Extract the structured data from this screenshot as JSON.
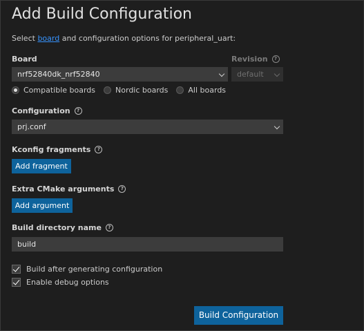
{
  "title": "Add Build Configuration",
  "intro": {
    "before": "Select ",
    "link": "board",
    "after": " and configuration options for peripheral_uart:"
  },
  "board": {
    "label": "Board",
    "value": "nrf52840dk_nrf52840"
  },
  "revision": {
    "label": "Revision",
    "value": "default"
  },
  "board_filter": {
    "options": [
      "Compatible boards",
      "Nordic boards",
      "All boards"
    ],
    "selected": "Compatible boards"
  },
  "configuration": {
    "label": "Configuration",
    "value": "prj.conf"
  },
  "kconfig": {
    "label": "Kconfig fragments",
    "button": "Add fragment"
  },
  "cmake": {
    "label": "Extra CMake arguments",
    "button": "Add argument"
  },
  "build_dir": {
    "label": "Build directory name",
    "value": "build"
  },
  "options": [
    {
      "label": "Build after generating configuration",
      "checked": true
    },
    {
      "label": "Enable debug options",
      "checked": true
    }
  ],
  "submit": "Build Configuration",
  "colors": {
    "background": "#1e1e1e",
    "button": "#0e639c",
    "link": "#3794ff",
    "field": "#3c3c3c"
  },
  "icons": {
    "help": "help-circle-icon",
    "dropdown": "chevron-down-icon",
    "check": "checkmark-icon"
  }
}
